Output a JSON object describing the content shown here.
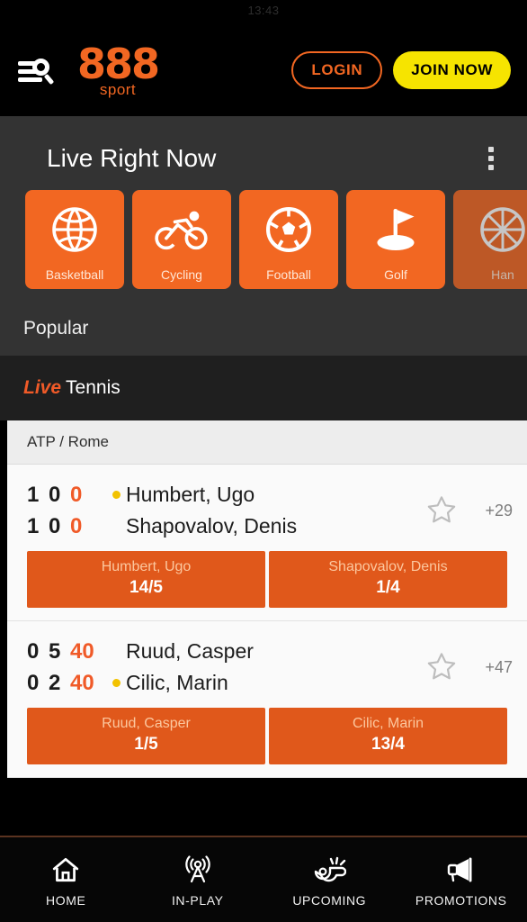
{
  "status_bar": {
    "clock": "13:43"
  },
  "header": {
    "menu_search_icon": "menu-search-icon",
    "logo_main": "888",
    "logo_sub": "sport",
    "login_label": "LOGIN",
    "join_label": "JOIN NOW"
  },
  "live_section": {
    "title": "Live Right Now",
    "menu_icon": "kebab-menu-icon",
    "tiles": [
      {
        "label": "Basketball",
        "icon": "basketball-icon"
      },
      {
        "label": "Cycling",
        "icon": "cycling-icon"
      },
      {
        "label": "Football",
        "icon": "football-icon"
      },
      {
        "label": "Golf",
        "icon": "golf-icon"
      },
      {
        "label": "Han",
        "icon": "handball-icon"
      }
    ]
  },
  "popular": {
    "label": "Popular"
  },
  "sport_header": {
    "live_label": "Live",
    "sport_name": "Tennis"
  },
  "league": {
    "name": "ATP / Rome"
  },
  "matches": [
    {
      "league": "ATP / Rome",
      "markets_badge": "+29",
      "favorite_icon": "star-outline-icon",
      "players": [
        {
          "name": "Humbert, Ugo",
          "serving": true,
          "scores": [
            "1",
            "0"
          ],
          "points": "0"
        },
        {
          "name": "Shapovalov, Denis",
          "serving": false,
          "scores": [
            "1",
            "0"
          ],
          "points": "0"
        }
      ],
      "odds": [
        {
          "name": "Humbert, Ugo",
          "value": "14/5"
        },
        {
          "name": "Shapovalov, Denis",
          "value": "1/4"
        }
      ]
    },
    {
      "league": "ATP / Rome",
      "markets_badge": "+47",
      "favorite_icon": "star-outline-icon",
      "players": [
        {
          "name": "Ruud, Casper",
          "serving": false,
          "scores": [
            "0",
            "5"
          ],
          "points": "40"
        },
        {
          "name": "Cilic, Marin",
          "serving": true,
          "scores": [
            "0",
            "2"
          ],
          "points": "40"
        }
      ],
      "odds": [
        {
          "name": "Ruud, Casper",
          "value": "1/5"
        },
        {
          "name": "Cilic, Marin",
          "value": "13/4"
        }
      ]
    }
  ],
  "bottom_nav": [
    {
      "label": "HOME",
      "icon": "home-icon"
    },
    {
      "label": "IN-PLAY",
      "icon": "broadcast-tower-icon"
    },
    {
      "label": "UPCOMING",
      "icon": "whistle-icon"
    },
    {
      "label": "PROMOTIONS",
      "icon": "megaphone-icon"
    }
  ],
  "colors": {
    "brand_orange": "#f26722",
    "odds_orange": "#e0581b",
    "join_yellow": "#f6e400",
    "live_red": "#f05a28",
    "serve_dot": "#f2c200"
  }
}
